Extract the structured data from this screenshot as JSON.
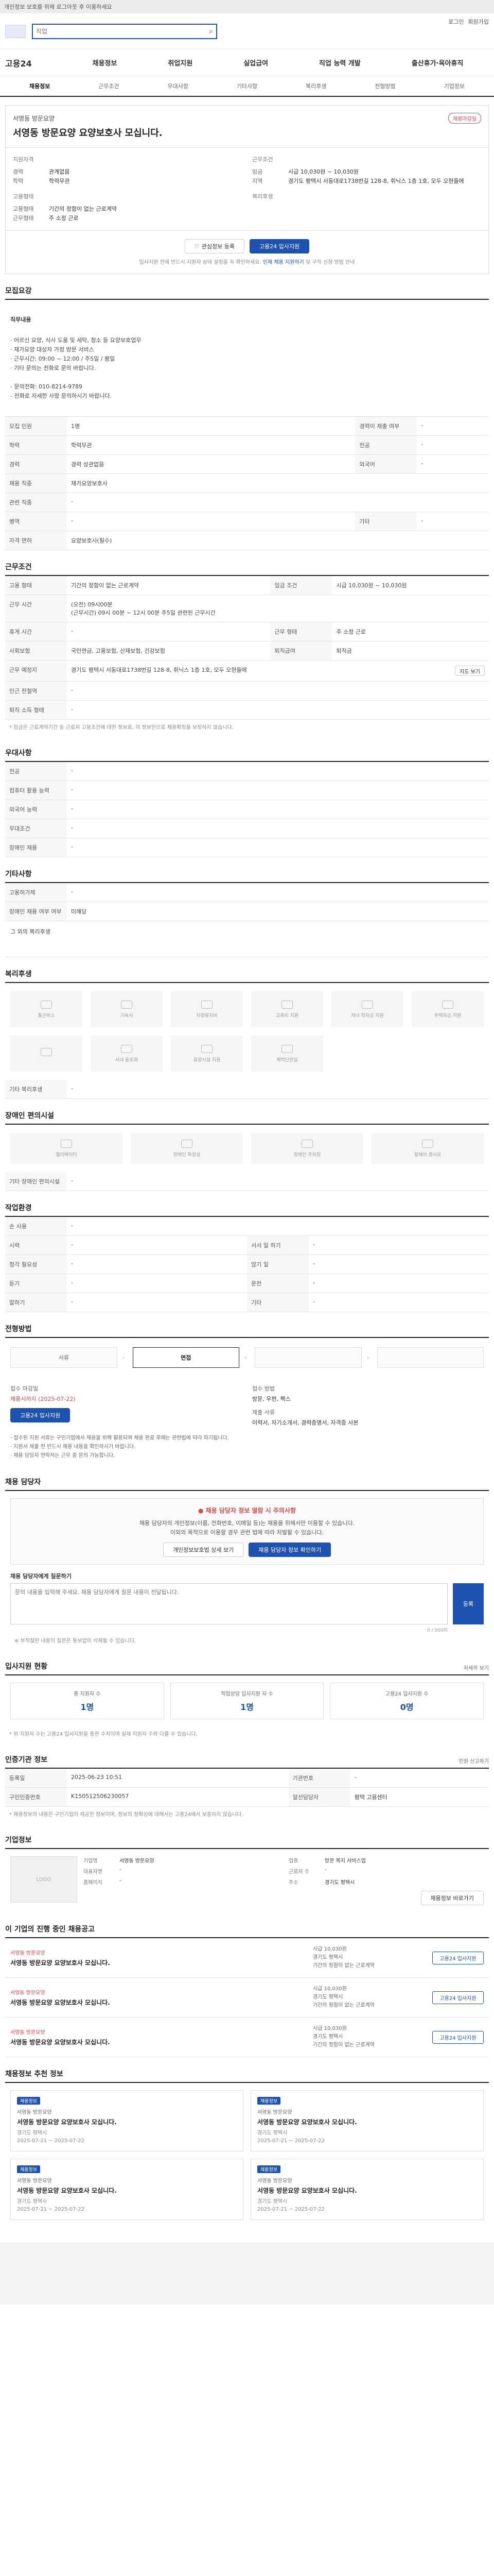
{
  "notice": "개인정보 보호를 위해 로그아웃 후 이용하세요",
  "header": {
    "search_placeholder": "직업",
    "util_links": [
      "로그인",
      "회원가입"
    ]
  },
  "gnb": {
    "brand": "고용24",
    "items": [
      "채용정보",
      "취업지원",
      "실업급여",
      "직업 능력 개발",
      "출산휴가·육아휴직"
    ]
  },
  "tabs": [
    "채용정보",
    "근무조건",
    "우대사항",
    "기타사항",
    "복리후생",
    "전형방법",
    "기업정보"
  ],
  "job": {
    "company": "서영동 방문요양",
    "title": "서영동 방문요양 요양보호사 모십니다.",
    "badge": "채용마감일",
    "summary_left_title": "지원자격",
    "summary_left": [
      {
        "k": "경력",
        "v": "관계없음"
      },
      {
        "k": "학력",
        "v": "학력무관"
      }
    ],
    "summary_right_title": "근무조건",
    "summary_right": [
      {
        "k": "임금",
        "v": "시급 10,030원 ~ 10,030원"
      },
      {
        "k": "지역",
        "v": "경기도 평택시 서동대로1738번길 128-8, 휘닉스 1층 1호, 모두 오현들에"
      }
    ],
    "summary_left2_title": "고용형태",
    "summary_left2": [
      {
        "k": "고용형태",
        "v": "기간의 정함이 없는 근로계약"
      },
      {
        "k": "근무형태",
        "v": "주 소정 근로"
      }
    ],
    "summary_right2_title": "복리후생",
    "buttons": {
      "scrap": "관심정보 등록",
      "apply": "고용24 입사지원"
    },
    "action_note_pre": "입사지원 전에 반드시 지원자 상태 설정을 꼭 확인하세요.",
    "action_note_link": "인재 채용 지원하기",
    "action_note_post": "및 구직 신청 방법 안내"
  },
  "recruit_section": {
    "title": "모집요강",
    "duty_label": "직무내용",
    "duty_text": "· 어르신 요양, 식사 도움 및 세탁, 청소 등 요양보호업무\n· 재가요양 대상자 가정 방문 서비스\n· 근무시간: 09:00 ~ 12:00 / 주5일 / 평일\n· 기타 문의는 전화로 문의 바랍니다.\n\n- 문의전화: 010-8214-9789\n- 전화로 자세한 사항 문의하시기 바랍니다.",
    "rows": [
      {
        "k": "모집 인원",
        "v": "1명",
        "k2": "경력이 제출 여부",
        "v2": "-"
      },
      {
        "k": "학력",
        "v": "학력무관",
        "k2": "전공",
        "v2": "-"
      },
      {
        "k": "경력",
        "v": "경력 상관없음",
        "k2": "외국어",
        "v2": "-"
      },
      {
        "k": "채용 직종",
        "v": "재가요양보호사",
        "k2": "",
        "v2": ""
      },
      {
        "k": "관련 직종",
        "v": "-",
        "k2": "",
        "v2": ""
      },
      {
        "k": "병역",
        "v": "-",
        "k2": "기타",
        "v2": "-"
      },
      {
        "k": "자격 면허",
        "v": "요양보호사(필수)",
        "k2": "",
        "v2": ""
      }
    ]
  },
  "condition_section": {
    "title": "근무조건",
    "rows": [
      {
        "k": "고용 형태",
        "v": "기간의 정함이 없는 근로계약",
        "k2": "임금 조건",
        "v2": "시급 10,030원 ~ 10,030원"
      },
      {
        "k": "근무 시간",
        "v": "(오전) 09시00분\n(근무시간) 09시 00분 ~ 12시 00분 주5일 관련된 근무시간",
        "k2": "",
        "v2": ""
      },
      {
        "k": "휴게 시간",
        "v": "-",
        "k2": "근무 형태",
        "v2": "주 소정 근로"
      },
      {
        "k": "사회보험",
        "v": "국민연금, 고용보험, 산재보험, 건강보험",
        "k2": "퇴직급여",
        "v2": "퇴직금"
      },
      {
        "k": "근무 예정지",
        "v": "경기도 평택시 서동대로1738번길 128-8, 휘닉스 1층 1호, 모두 오현들에",
        "k2": "",
        "v2": ""
      },
      {
        "k": "인근 전철역",
        "v": "-",
        "k2": "",
        "v2": ""
      },
      {
        "k": "퇴직 소득 형태",
        "v": "-",
        "k2": "",
        "v2": ""
      }
    ],
    "map_btn": "지도 보기",
    "note": "* 임금은 근로계약기간 등 근로자 고용조건에 대한 정보로, 이 정보만으로 채용확정을 보장하지 않습니다."
  },
  "pref_section": {
    "title": "우대사항",
    "rows": [
      {
        "k": "전공",
        "v": "-"
      },
      {
        "k": "컴퓨터 활용 능력",
        "v": "-"
      },
      {
        "k": "외국어 능력",
        "v": "-"
      },
      {
        "k": "우대조건",
        "v": "-"
      },
      {
        "k": "장애인 채용",
        "v": "-"
      }
    ]
  },
  "etc_section": {
    "title": "기타사항",
    "rows": [
      {
        "k": "고용허가제",
        "v": "-"
      },
      {
        "k": "장애인 채용 여부 여부",
        "v": "미해당"
      }
    ],
    "sub": "그 외의 복리후생"
  },
  "welfare_section": {
    "title": "복리후생",
    "items": [
      "통근버스",
      "기숙사",
      "차량유지비",
      "교육비 지원",
      "자녀 학자금 지원",
      "주택자금 지원",
      "",
      "사내 동호회",
      "휴양시설 지원",
      "체력단련실",
      "",
      ""
    ],
    "etc_label": "기타 복리후생",
    "etc_value": "-"
  },
  "facility_section": {
    "title": "장애인 편의시설",
    "items": [
      "엘리베이터",
      "장애인 화장실",
      "장애인 주차장",
      "휠체어 경사로"
    ],
    "etc_label": "기타 장애인 편의시설",
    "etc_value": "-"
  },
  "work_env_section": {
    "title": "작업환경",
    "rows": [
      {
        "k": "손 사용",
        "v": "-",
        "k2": "",
        "v2": ""
      },
      {
        "k": "시력",
        "v": "-",
        "k2": "서서 일 하기",
        "v2": "-"
      },
      {
        "k": "청각 필요성",
        "v": "-",
        "k2": "앉기 일",
        "v2": "-"
      },
      {
        "k": "듣기",
        "v": "-",
        "k2": "운전",
        "v2": "-"
      },
      {
        "k": "말하기",
        "v": "-",
        "k2": "기타",
        "v2": "-"
      }
    ]
  },
  "process_section": {
    "title": "전형방법",
    "steps": [
      "서류",
      "면접",
      "",
      ""
    ],
    "apply_k1": "접수 마감일",
    "apply_v1": "채용시까지 (2025-07-22)",
    "apply_k2": "접수 방법",
    "apply_v2": "방문, 우편, 팩스",
    "apply_k3": "제출 서류",
    "apply_v3": "이력서, 자기소개서, 경력증명서, 자격증 사본",
    "apply_btn": "고용24 입사지원",
    "bullets": "· 접수된 지원 서류는 구인기업에서 채용을 위해 활용되며 채용 완료 후에는 관련법에 따라 파기됩니다.\n· 지원서 제출 전 반드시 채용 내용을 확인하시기 바랍니다.\n· 채용 담당자 연락처는 근무 중 문의 가능합니다."
  },
  "contact_section": {
    "title": "채용 담당자",
    "alert": "채용 담당자 정보 열람 시 주의사항",
    "text": "채용 담당자의 개인정보(이름, 전화번호, 이메일 등)는 채용을 위해서만 이용할 수 있습니다.\n이외의 목적으로 이용할 경우 관련 법에 따라 처벌될 수 있습니다.",
    "btn1": "개인정보보호법 상세 보기",
    "btn2": "채용 담당자 정보 확인하기",
    "msg_label": "채용 담당자에게 질문하기",
    "msg_placeholder": "문의 내용을 입력해 주세요. 채용 담당자에게 질문 내용이 전달됩니다.",
    "msg_send": "등록",
    "msg_count": "0 / 500자",
    "msg_note": "※ 부적절한 내용의 질문은 통보없이 삭제될 수 있습니다."
  },
  "stats_section": {
    "title": "입사지원 현황",
    "side": "자세히 보기",
    "items": [
      {
        "label": "총 지원자 수",
        "value": "1명"
      },
      {
        "label": "직업상담 입사지원 자 수",
        "value": "1명"
      },
      {
        "label": "고용24 입사지원 수",
        "value": "0명"
      }
    ],
    "note": "* 위 지원자 수는 고용24 입사지원을 통한 수치이며 실제 지원자 수와 다를 수 있습니다."
  },
  "info_section": {
    "title": "인증기관 정보",
    "side": "민원 신고하기",
    "rows": [
      {
        "k": "등록일",
        "v": "2025-06-23 10:51",
        "k2": "기관번호",
        "v2": "-"
      },
      {
        "k": "구인인증번호",
        "v": "K150512506230057",
        "k2": "알선담당자",
        "v2": "평택 고용센터"
      }
    ],
    "note": "* 채용정보의 내용은 구인기업이 제공한 정보이며, 정보의 정확성에 대해서는 고용24에서 보증하지 않습니다."
  },
  "company_section": {
    "title": "기업정보",
    "logo": "LOGO",
    "rows": [
      {
        "k": "기업명",
        "v": "서영동 방문요양"
      },
      {
        "k": "업종",
        "v": "방문 복지 서비스업"
      },
      {
        "k": "대표자명",
        "v": "-"
      },
      {
        "k": "근로자 수",
        "v": "-"
      },
      {
        "k": "홈페이지",
        "v": "-"
      },
      {
        "k": "주소",
        "v": "경기도 평택시"
      }
    ],
    "btn": "채용정보 바로가기"
  },
  "other_postings": {
    "title": "이 기업의 진행 중인 채용공고",
    "cards": [
      {
        "company": "서영동 방문요양",
        "title": "서영동 방문요양 요양보호사 모십니다.",
        "meta": "시급 10,030원\n경기도 평택시\n기간의 정함이 없는 근로계약",
        "btn": "고용24 입사지원"
      },
      {
        "company": "서영동 방문요양",
        "title": "서영동 방문요양 요양보호사 모십니다.",
        "meta": "시급 10,030원\n경기도 평택시\n기간의 정함이 없는 근로계약",
        "btn": "고용24 입사지원"
      },
      {
        "company": "서영동 방문요양",
        "title": "서영동 방문요양 요양보호사 모십니다.",
        "meta": "시급 10,030원\n경기도 평택시\n기간의 정함이 없는 근로계약",
        "btn": "고용24 입사지원"
      }
    ]
  },
  "recommend": {
    "title": "채용정보 추천 정보",
    "cards": [
      {
        "tag": "채용정보",
        "company": "서영동 방문요양",
        "title": "서영동 방문요양 요양보호사 모십니다.",
        "meta": "경기도 평택시\n2025-07-21 ~ 2025-07-22"
      },
      {
        "tag": "채용정보",
        "company": "서영동 방문요양",
        "title": "서영동 방문요양 요양보호사 모십니다.",
        "meta": "경기도 평택시\n2025-07-21 ~ 2025-07-22"
      },
      {
        "tag": "채용정보",
        "company": "서영동 방문요양",
        "title": "서영동 방문요양 요양보호사 모십니다.",
        "meta": "경기도 평택시\n2025-07-21 ~ 2025-07-22"
      },
      {
        "tag": "채용정보",
        "company": "서영동 방문요양",
        "title": "서영동 방문요양 요양보호사 모십니다.",
        "meta": "경기도 평택시\n2025-07-21 ~ 2025-07-22"
      }
    ]
  }
}
